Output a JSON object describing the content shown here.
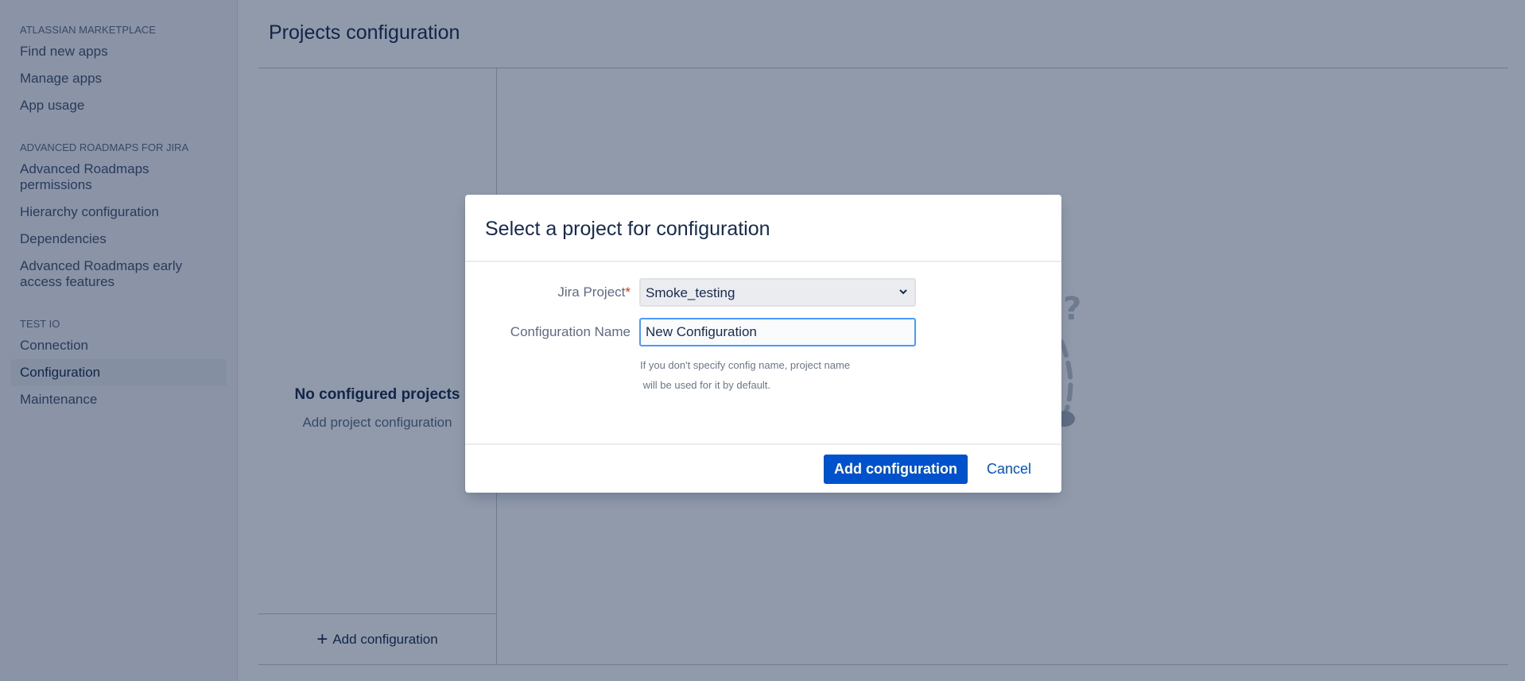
{
  "sidebar": {
    "sections": [
      {
        "heading": "Atlassian Marketplace",
        "items": [
          {
            "label": "Find new apps"
          },
          {
            "label": "Manage apps"
          },
          {
            "label": "App usage"
          }
        ]
      },
      {
        "heading": "Advanced Roadmaps for Jira",
        "items": [
          {
            "label": "Advanced Roadmaps permissions"
          },
          {
            "label": "Hierarchy configuration"
          },
          {
            "label": "Dependencies"
          },
          {
            "label": "Advanced Roadmaps early access features"
          }
        ]
      },
      {
        "heading": "Test IO",
        "items": [
          {
            "label": "Connection"
          },
          {
            "label": "Configuration",
            "selected": true
          },
          {
            "label": "Maintenance"
          }
        ]
      }
    ]
  },
  "main": {
    "title": "Projects configuration",
    "empty_state": {
      "title": "No configured projects",
      "subtitle": "Add project configuration"
    },
    "add_configuration_label": "Add configuration",
    "illustration_icon": "question-mark-illustration"
  },
  "modal": {
    "title": "Select a project for configuration",
    "fields": {
      "project": {
        "label": "Jira Project",
        "required_marker": "*",
        "selected_value": "Smoke_testing"
      },
      "config_name": {
        "label": "Configuration Name",
        "value": "New Configuration",
        "help_line1": "If you don't specify config name, project name",
        "help_line2": " will be used for it by default."
      }
    },
    "buttons": {
      "submit": "Add configuration",
      "cancel": "Cancel"
    }
  },
  "colors": {
    "primary": "#0052cc",
    "focus_border": "#4c9aff",
    "required": "#de350b",
    "text_primary": "#172b4d",
    "text_secondary": "#5e6c84"
  }
}
